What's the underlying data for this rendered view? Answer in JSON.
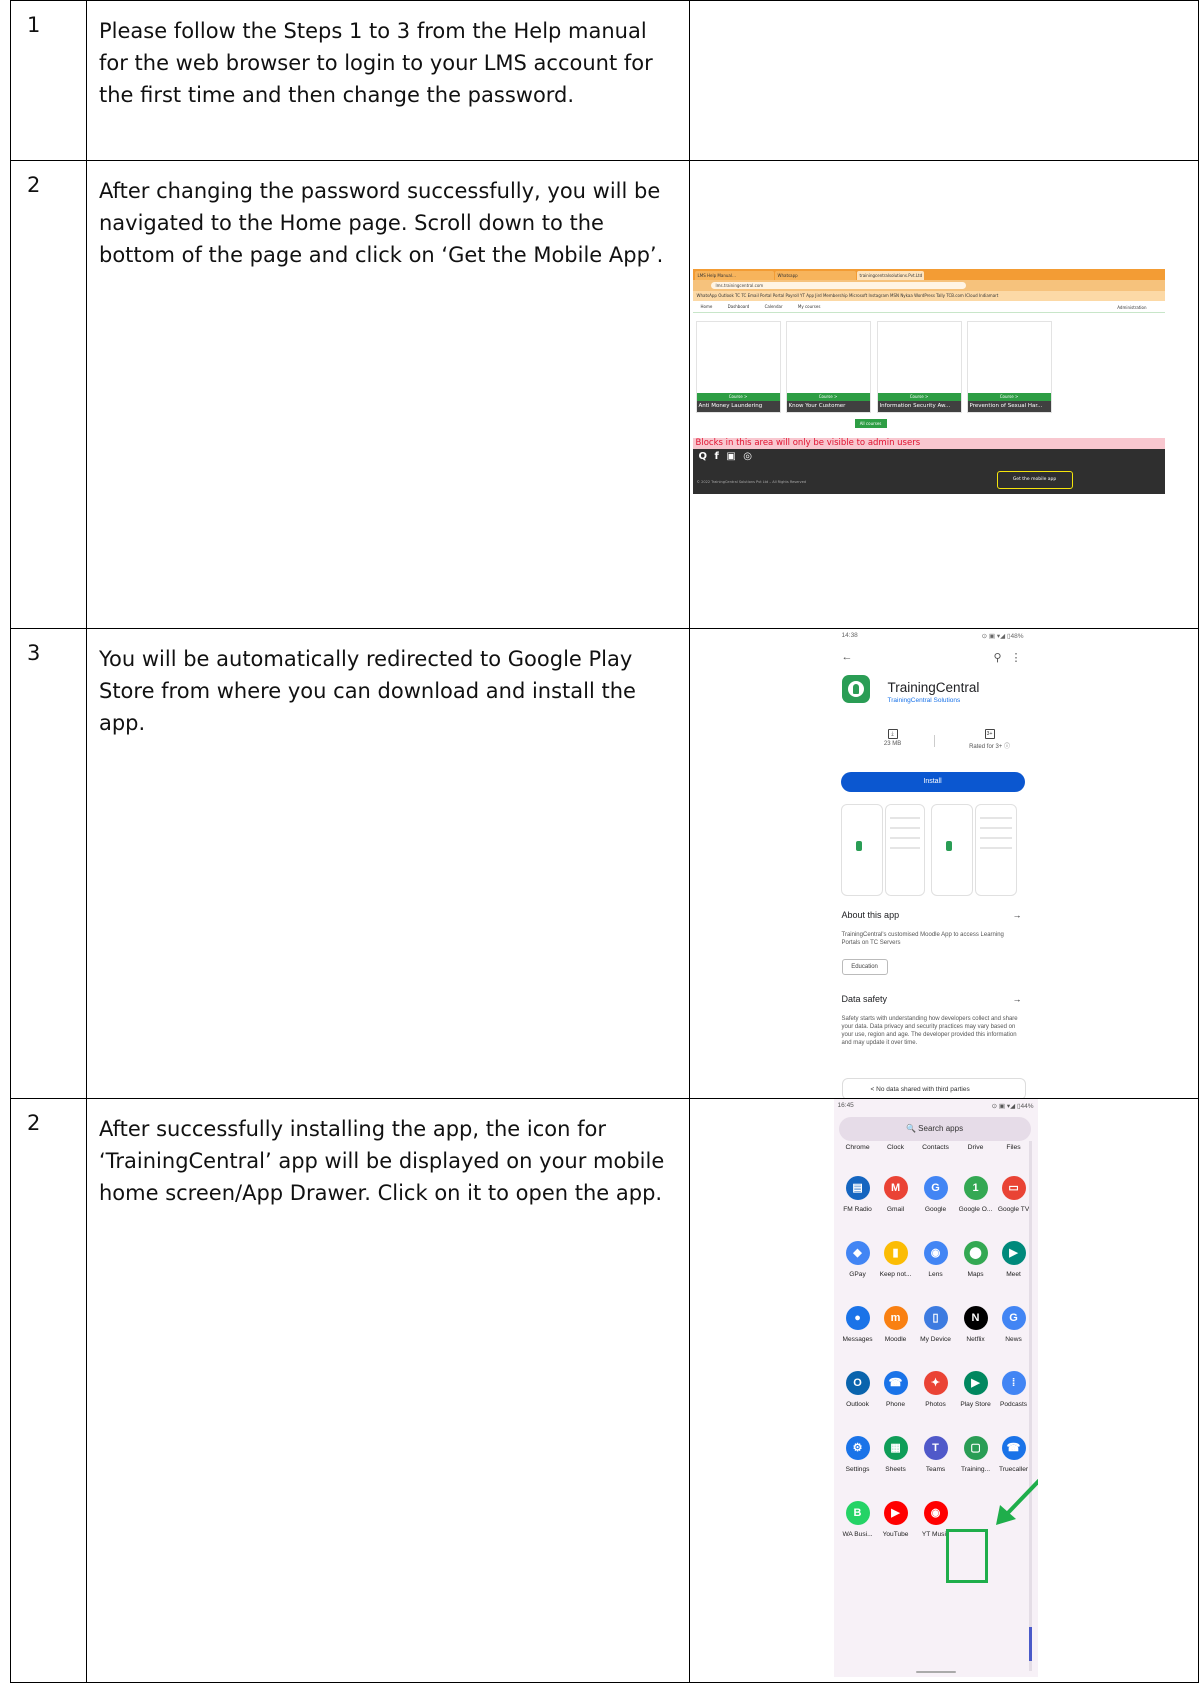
{
  "rows": [
    {
      "num": "1",
      "text": "Please follow the Steps 1 to 3 from the Help manual for the web browser to login to your LMS account for the first time and then change the password."
    },
    {
      "num": "2",
      "text": "After changing the password successfully, you will be navigated to the Home page. Scroll down to the bottom of the page and click on ‘Get the Mobile App’.",
      "screenshot": {
        "tab1": "LMS Help Manual…",
        "tab2": "Whatsapp",
        "tab3": "trainingcentralsolutions.Pvt.Ltd",
        "url": "lms.trainingcentral.com",
        "bookmarks": "WhatsApp  Outlook  TC  TC Email  Portal  Portal  Payroll  YT App  Jird  Membership  Microsoft  Instagram  MSN  Nykaa  WordPress  Tally  TCB.com  ICloud  Indiamart",
        "nav": [
          "Home",
          "Dashboard",
          "Calendar",
          "My courses"
        ],
        "nav_right": "Administration",
        "courses": [
          {
            "button": "Course >",
            "title": "Anti Money Laundering"
          },
          {
            "button": "Course >",
            "title": "Know Your Customer"
          },
          {
            "button": "Course >",
            "title": "Information Security Aw..."
          },
          {
            "button": "Course >",
            "title": "Prevention of Sexual Har..."
          }
        ],
        "all_courses": "All courses",
        "admin_notice": "Blocks in this area will only be visible to admin users",
        "social": "Q f ▣ ◎",
        "copyright": "© 2022 TrainingCentral Solutions Pvt Ltd – All Rights Reserved",
        "get_app": "Get the mobile app"
      }
    },
    {
      "num": "3",
      "text": "You will be automatically redirected to Google Play Store from where you can download and install the app.",
      "screenshot": {
        "time": "14:38",
        "status_right": "⊙ ▣ ▾◢ ▯48%",
        "app_name": "TrainingCentral",
        "developer": "TrainingCentral Solutions",
        "size": "23 MB",
        "rating": "Rated for 3+ ⓘ",
        "rating_icon": "3+",
        "install": "Install",
        "about_title": "About this app",
        "about_text": "TrainingCentral's customised Moodle App to access Learning Portals on TC Servers",
        "chip": "Education",
        "safety_title": "Data safety",
        "safety_text": "Safety starts with understanding how developers collect and share your data. Data privacy and security practices may vary based on your use, region and age. The developer provided this information and may update it over time.",
        "no_data": "No data shared with third parties"
      }
    },
    {
      "num": "2",
      "text": "After successfully installing the app, the icon for ‘TrainingCentral’ app will be displayed on your mobile home screen/App Drawer. Click on it to open the app.",
      "screenshot": {
        "time": "16:45",
        "status_right": "⊙ ▣ ▾◢ ▯44%",
        "search": "🔍 Search apps",
        "top_row": [
          "Chrome",
          "Clock",
          "Contacts",
          "Drive",
          "Files"
        ],
        "apps": [
          [
            {
              "label": "FM Radio",
              "glyph": "▤",
              "color": "#1565c0"
            },
            {
              "label": "Gmail",
              "glyph": "M",
              "color": "#ea4335"
            },
            {
              "label": "Google",
              "glyph": "G",
              "color": "#4285f4"
            },
            {
              "label": "Google O...",
              "glyph": "1",
              "color": "#34a853"
            },
            {
              "label": "Google TV",
              "glyph": "▭",
              "color": "#e94335"
            }
          ],
          [
            {
              "label": "GPay",
              "glyph": "◆",
              "color": "#4285f4"
            },
            {
              "label": "Keep not...",
              "glyph": "▮",
              "color": "#fbbc04"
            },
            {
              "label": "Lens",
              "glyph": "◉",
              "color": "#4285f4"
            },
            {
              "label": "Maps",
              "glyph": "⬤",
              "color": "#34a853"
            },
            {
              "label": "Meet",
              "glyph": "▶",
              "color": "#00897b"
            }
          ],
          [
            {
              "label": "Messages",
              "glyph": "●",
              "color": "#1a73e8"
            },
            {
              "label": "Moodle",
              "glyph": "m",
              "color": "#f98012"
            },
            {
              "label": "My Device",
              "glyph": "▯",
              "color": "#3d7be0"
            },
            {
              "label": "Netflix",
              "glyph": "N",
              "color": "#000000"
            },
            {
              "label": "News",
              "glyph": "G",
              "color": "#4285f4"
            }
          ],
          [
            {
              "label": "Outlook",
              "glyph": "O",
              "color": "#0a64ad"
            },
            {
              "label": "Phone",
              "glyph": "☎",
              "color": "#1a73e8"
            },
            {
              "label": "Photos",
              "glyph": "✦",
              "color": "#ea4335"
            },
            {
              "label": "Play Store",
              "glyph": "▶",
              "color": "#01875f"
            },
            {
              "label": "Podcasts",
              "glyph": "⁞",
              "color": "#4285f4"
            }
          ],
          [
            {
              "label": "Settings",
              "glyph": "⚙",
              "color": "#1a73e8"
            },
            {
              "label": "Sheets",
              "glyph": "▦",
              "color": "#0f9d58"
            },
            {
              "label": "Teams",
              "glyph": "T",
              "color": "#5059c9"
            },
            {
              "label": "Training...",
              "glyph": "▢",
              "color": "#2a9d55"
            },
            {
              "label": "Truecaller",
              "glyph": "☎",
              "color": "#1a73e8"
            }
          ],
          [
            {
              "label": "WA Busi...",
              "glyph": "B",
              "color": "#25d366"
            },
            {
              "label": "YouTube",
              "glyph": "▶",
              "color": "#ff0000"
            },
            {
              "label": "YT Music",
              "glyph": "◉",
              "color": "#ff0000"
            }
          ]
        ]
      }
    }
  ],
  "colors": {
    "highlight": "#1fae4b",
    "brand_green": "#2e9e44",
    "play_blue": "#0b57d0"
  }
}
